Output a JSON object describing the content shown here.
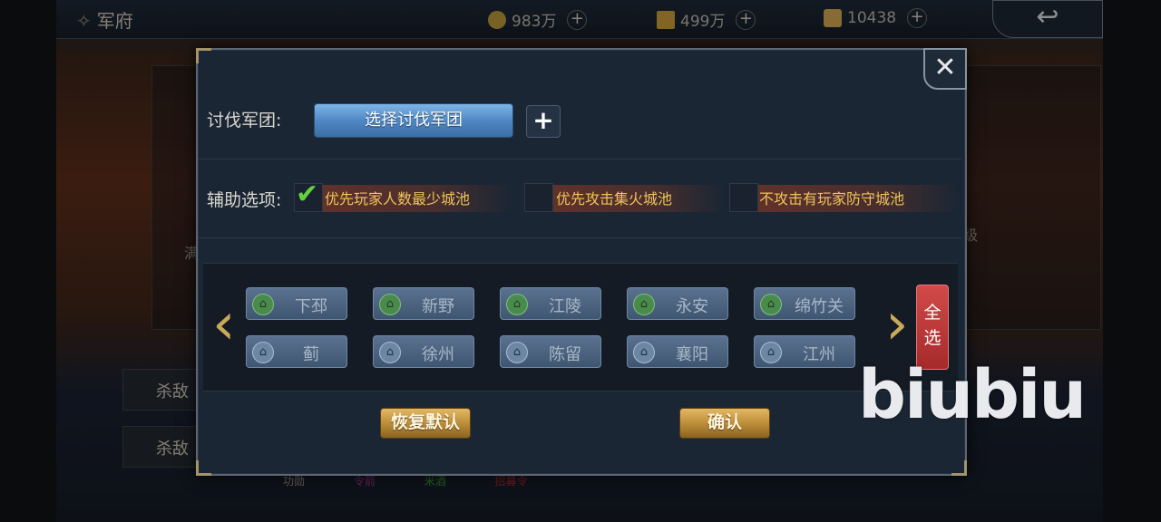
{
  "top_bar": {
    "title": "军府",
    "resources": [
      {
        "icon": "coin-icon",
        "value": "983万",
        "color": "#b8963a"
      },
      {
        "icon": "grain-icon",
        "value": "499万",
        "color": "#c89a3c"
      },
      {
        "icon": "ingot-icon",
        "value": "10438",
        "color": "#d0a450"
      }
    ]
  },
  "background": {
    "kill_row_1": "杀敌",
    "kill_row_2": "杀敌",
    "side_text_right": "级",
    "side_text_left": "满",
    "bottom_labels": [
      "功勋",
      "令箭",
      "米酒",
      "招募令"
    ]
  },
  "modal": {
    "army_label": "讨伐军团:",
    "select_army_button": "选择讨伐军团",
    "assist_label": "辅助选项:",
    "options": [
      {
        "label": "优先玩家人数最少城池",
        "checked": true
      },
      {
        "label": "优先攻击集火城池",
        "checked": false
      },
      {
        "label": "不攻击有玩家防守城池",
        "checked": false
      }
    ],
    "cities": [
      {
        "name": "下邳",
        "icon": "green"
      },
      {
        "name": "新野",
        "icon": "green"
      },
      {
        "name": "江陵",
        "icon": "green"
      },
      {
        "name": "永安",
        "icon": "green"
      },
      {
        "name": "绵竹关",
        "icon": "green"
      },
      {
        "name": "蓟",
        "icon": "blue"
      },
      {
        "name": "徐州",
        "icon": "blue"
      },
      {
        "name": "陈留",
        "icon": "blue"
      },
      {
        "name": "襄阳",
        "icon": "blue"
      },
      {
        "name": "江州",
        "icon": "blue"
      }
    ],
    "select_all_button": "全选",
    "restore_default_button": "恢复默认",
    "confirm_button": "确认"
  },
  "watermark": "biubiu",
  "colors": {
    "accent_gold": "#f0c35a",
    "button_blue": "#4f88c4",
    "button_red": "#d24a4a",
    "check_green": "#63d13f"
  }
}
